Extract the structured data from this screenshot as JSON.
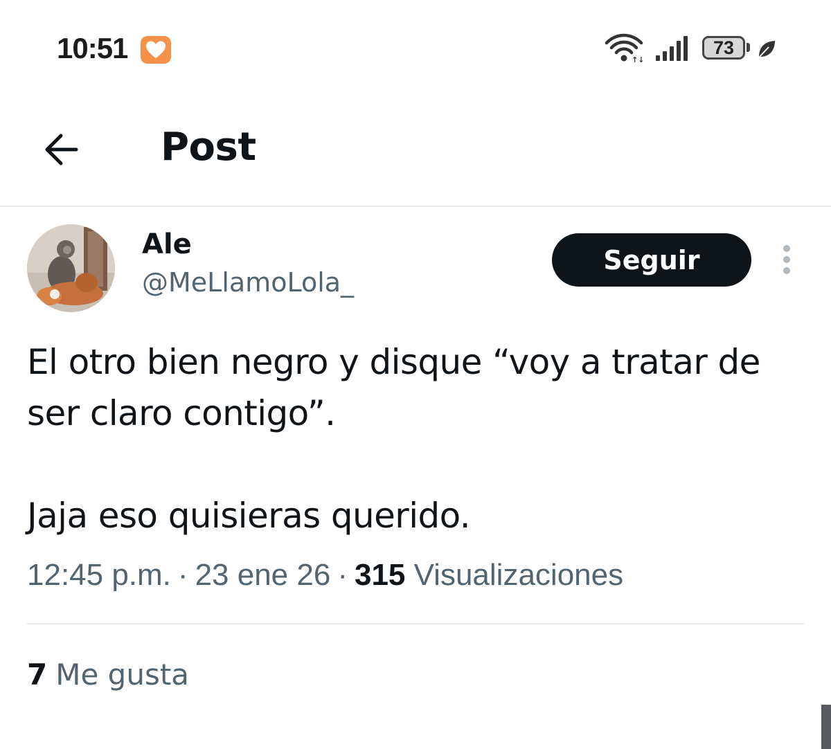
{
  "status_bar": {
    "time": "10:51",
    "battery_level": "73",
    "icons": [
      "heart-app-icon",
      "wifi-icon",
      "signal-icon",
      "battery-icon",
      "leaf-icon"
    ],
    "badge_color": "#f5924a"
  },
  "header": {
    "title": "Post",
    "back_icon": "arrow-left-icon"
  },
  "post": {
    "author": {
      "name": "Ale",
      "handle": "@MeLlamoLola_",
      "avatar_icon": "monkey-avatar"
    },
    "follow_label": "Seguir",
    "more_icon": "more-vertical-icon",
    "text_lines": [
      "El otro bien negro y disque “voy a tratar de ser claro contigo”.",
      "Jaja eso quisieras querido."
    ],
    "meta": {
      "time": "12:45 p.m.",
      "separator": "·",
      "date": "23 ene 26",
      "views_count": "315",
      "views_label": "Visualizaciones"
    },
    "likes": {
      "count": "7",
      "label": "Me gusta"
    }
  },
  "colors": {
    "text_primary": "#0f1419",
    "text_secondary": "#536471",
    "follow_button_bg": "#0f1419",
    "follow_button_text": "#ffffff",
    "divider": "#e3e6e8"
  }
}
